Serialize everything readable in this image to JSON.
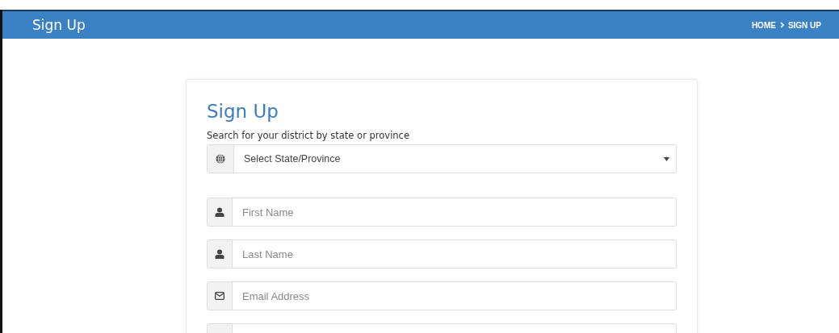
{
  "header": {
    "title": "Sign Up",
    "breadcrumb": [
      {
        "label": "HOME"
      },
      {
        "label": "SIGN UP"
      }
    ]
  },
  "form": {
    "title": "Sign Up",
    "label": "Search for your district by state or province",
    "select": {
      "kind": "globe",
      "placeholder": "Select State/Province"
    },
    "fields": [
      {
        "kind": "user",
        "placeholder": "First Name"
      },
      {
        "kind": "user",
        "placeholder": "Last Name"
      },
      {
        "kind": "envelope",
        "placeholder": "Email Address"
      },
      {
        "kind": "blank"
      }
    ]
  }
}
